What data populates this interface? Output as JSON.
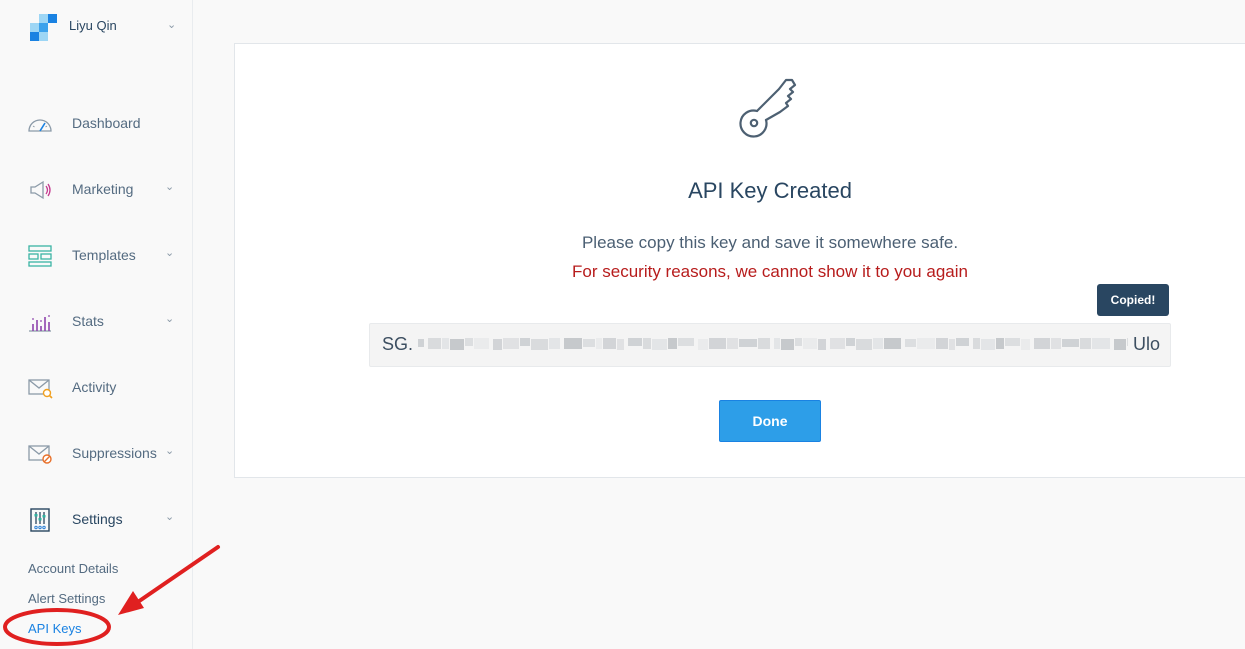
{
  "account": {
    "name": "Liyu Qin"
  },
  "sidebar": {
    "items": [
      {
        "label": "Dashboard",
        "icon": "gauge-icon",
        "has_chevron": false
      },
      {
        "label": "Marketing",
        "icon": "megaphone-icon",
        "has_chevron": true
      },
      {
        "label": "Templates",
        "icon": "templates-icon",
        "has_chevron": true
      },
      {
        "label": "Stats",
        "icon": "bar-chart-icon",
        "has_chevron": true
      },
      {
        "label": "Activity",
        "icon": "envelope-search-icon",
        "has_chevron": false
      },
      {
        "label": "Suppressions",
        "icon": "envelope-block-icon",
        "has_chevron": true
      },
      {
        "label": "Settings",
        "icon": "sliders-icon",
        "has_chevron": true,
        "expanded": true
      }
    ],
    "settings_subitems": [
      {
        "label": "Account Details",
        "active": false
      },
      {
        "label": "Alert Settings",
        "active": false
      },
      {
        "label": "API Keys",
        "active": true
      }
    ]
  },
  "modal": {
    "icon": "key-icon",
    "title": "API Key Created",
    "message": "Please copy this key and save it somewhere safe.",
    "warning": "For security reasons, we cannot show it to you again",
    "tooltip": "Copied!",
    "key_prefix": "SG.",
    "key_suffix": "Ulo",
    "done_label": "Done"
  },
  "colors": {
    "accent": "#1a82e2",
    "button": "#2d9ee8",
    "warning": "#b71c1c",
    "tooltip_bg": "#294661",
    "annotation": "#e02020"
  }
}
